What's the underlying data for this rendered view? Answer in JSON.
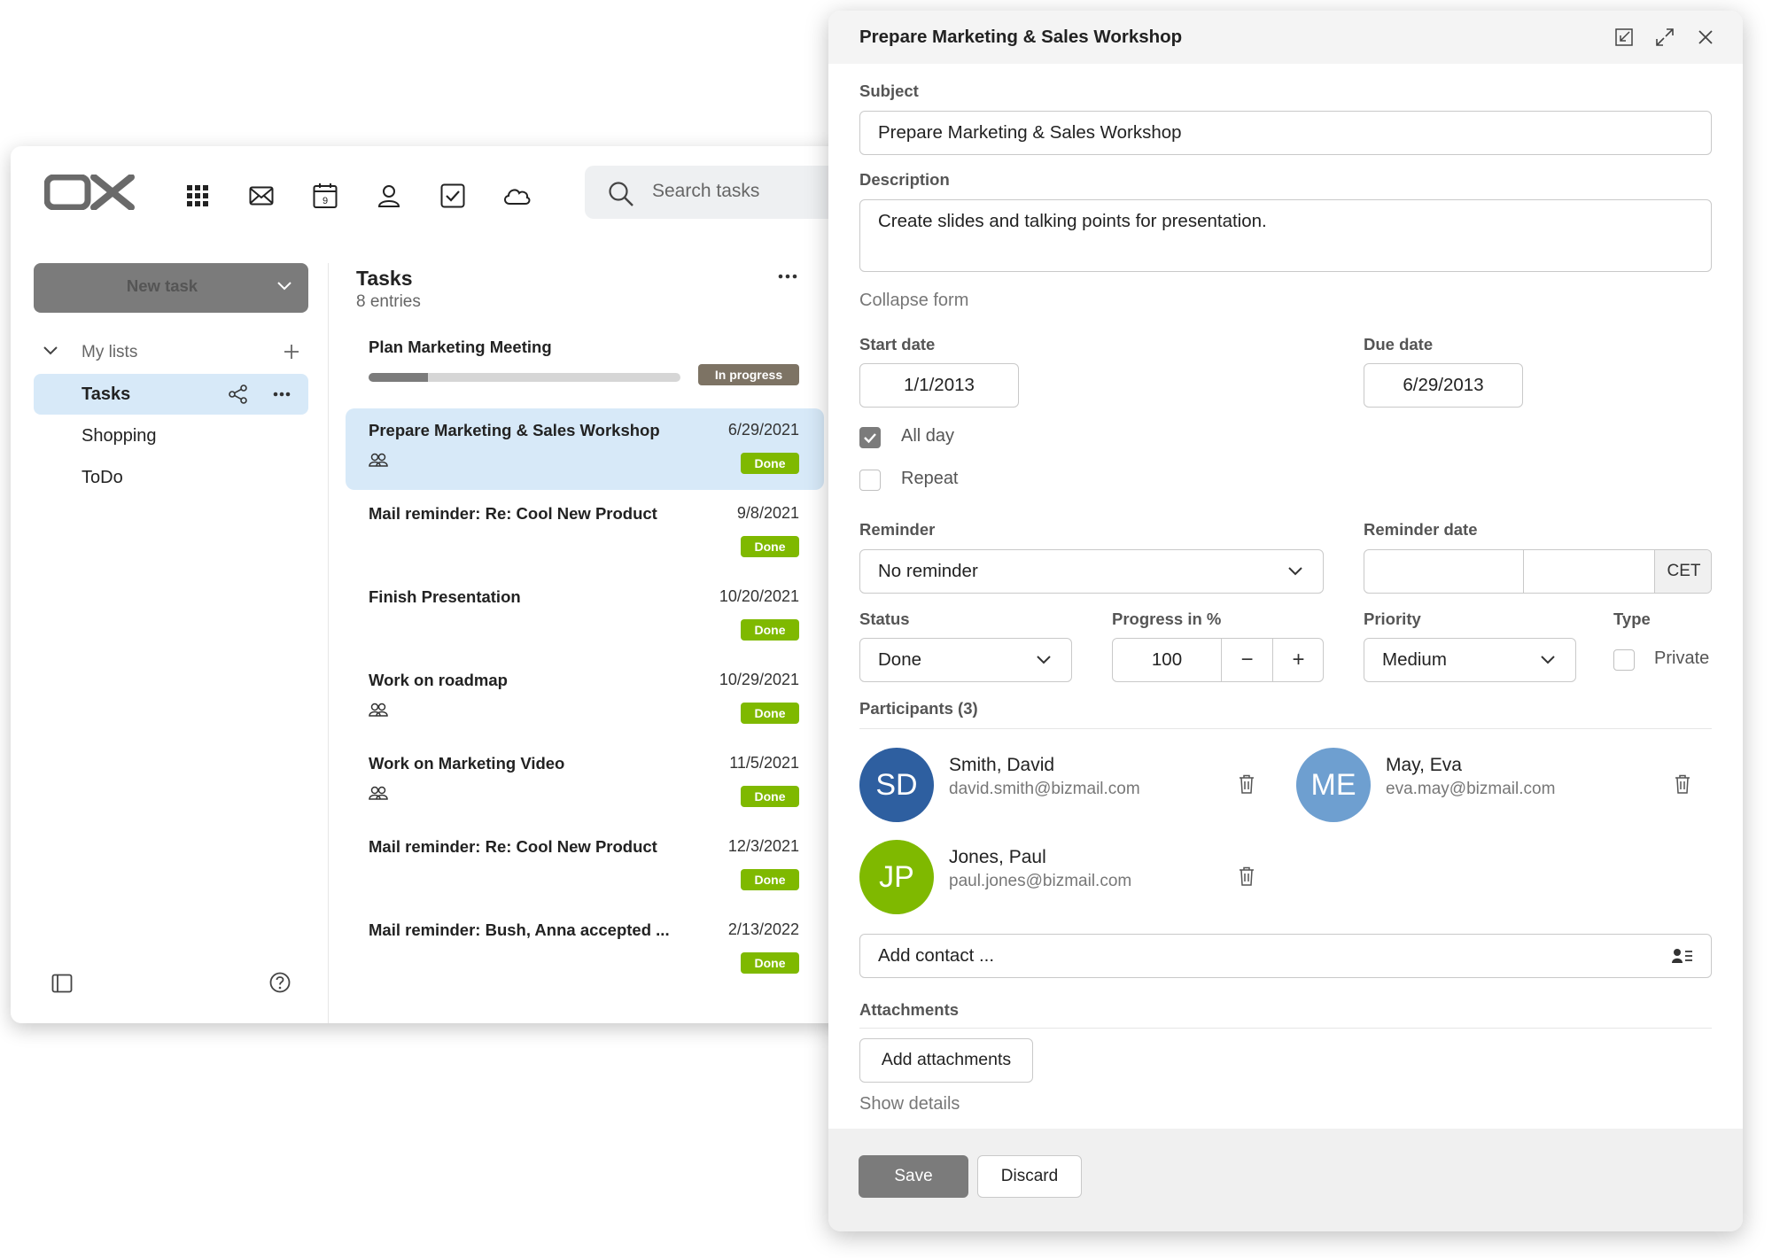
{
  "app": {
    "logo_text": "OX",
    "top_icons": [
      "apps-grid-icon",
      "mail-icon",
      "calendar-icon",
      "contacts-icon",
      "tasks-icon",
      "drive-cloud-icon"
    ],
    "calendar_day": "9",
    "search": {
      "placeholder": "Search tasks"
    },
    "new_task_label": "New task"
  },
  "sidebar": {
    "section_label": "My lists",
    "items": [
      {
        "label": "Tasks",
        "selected": true
      },
      {
        "label": "Shopping",
        "selected": false
      },
      {
        "label": "ToDo",
        "selected": false
      }
    ]
  },
  "task_list": {
    "title": "Tasks",
    "count": "8 entries",
    "tasks": [
      {
        "title": "Plan Marketing Meeting",
        "date": "",
        "status": "In progress",
        "progress": 0.19,
        "participants": false
      },
      {
        "title": "Prepare Marketing & Sales Workshop",
        "date": "6/29/2021",
        "status": "Done",
        "participants": true,
        "selected": true
      },
      {
        "title": "Mail reminder: Re: Cool New Product",
        "date": "9/8/2021",
        "status": "Done",
        "participants": false
      },
      {
        "title": "Finish Presentation",
        "date": "10/20/2021",
        "status": "Done",
        "participants": false
      },
      {
        "title": "Work on roadmap",
        "date": "10/29/2021",
        "status": "Done",
        "participants": true
      },
      {
        "title": "Work on Marketing Video",
        "date": "11/5/2021",
        "status": "Done",
        "participants": true
      },
      {
        "title": "Mail reminder: Re: Cool New Product",
        "date": "12/3/2021",
        "status": "Done",
        "participants": false
      },
      {
        "title": "Mail reminder: Bush, Anna accepted ...",
        "date": "2/13/2022",
        "status": "Done",
        "participants": false
      }
    ]
  },
  "editor": {
    "window_title": "Prepare Marketing & Sales Workshop",
    "subject_label": "Subject",
    "subject_value": "Prepare Marketing & Sales Workshop",
    "description_label": "Description",
    "description_value": "Create slides and talking points for presentation.",
    "collapse_form": "Collapse form",
    "start_date_label": "Start date",
    "start_date": "1/1/2013",
    "due_date_label": "Due date",
    "due_date": "6/29/2013",
    "all_day_label": "All day",
    "all_day_checked": true,
    "repeat_label": "Repeat",
    "repeat_checked": false,
    "reminder_label": "Reminder",
    "reminder_value": "No reminder",
    "reminder_date_label": "Reminder date",
    "timezone": "CET",
    "status_label": "Status",
    "status_value": "Done",
    "progress_label": "Progress in %",
    "progress_value": "100",
    "minus": "−",
    "plus": "+",
    "priority_label": "Priority",
    "priority_value": "Medium",
    "type_label": "Type",
    "private_label": "Private",
    "participants_label": "Participants (3)",
    "participants": [
      {
        "initials": "SD",
        "last": "Smith",
        "first": ", David",
        "email": "david.smith@bizmail.com",
        "color": "#2e5fa0"
      },
      {
        "initials": "ME",
        "last": "May",
        "first": ", Eva",
        "email": "eva.may@bizmail.com",
        "color": "#6e9fd0"
      },
      {
        "initials": "JP",
        "last": "Jones",
        "first": ", Paul",
        "email": "paul.jones@bizmail.com",
        "color": "#7fb900"
      }
    ],
    "add_contact_placeholder": "Add contact ...",
    "attachments_label": "Attachments",
    "add_attachments": "Add attachments",
    "show_details": "Show details",
    "save": "Save",
    "discard": "Discard"
  },
  "colors": {
    "accent_gray": "#7b7b7b",
    "selection_blue": "#d7e9f8",
    "done_green": "#7fb900",
    "progress_badge": "#7d7364"
  }
}
